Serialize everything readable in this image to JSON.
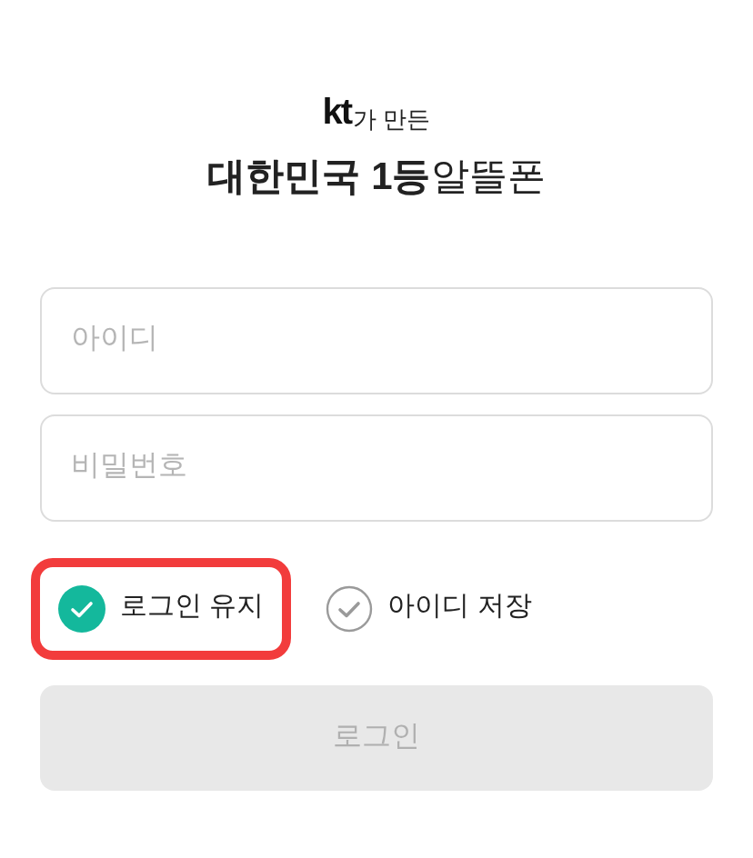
{
  "brand": {
    "logo": "kt",
    "tagline": "가 만든",
    "title": "**대한민국 1등**알뜰폰"
  },
  "fields": [
    {
      "placeholder": "아이디"
    },
    {
      "placeholder": "비밀번호"
    }
  ],
  "options": [
    {
      "label": "로그인 유지",
      "checked": true,
      "highlighted": true
    },
    {
      "label": "아이디 저장",
      "checked": false,
      "highlighted": false
    }
  ],
  "login_button": {
    "label": "로그인",
    "disabled": true
  }
}
